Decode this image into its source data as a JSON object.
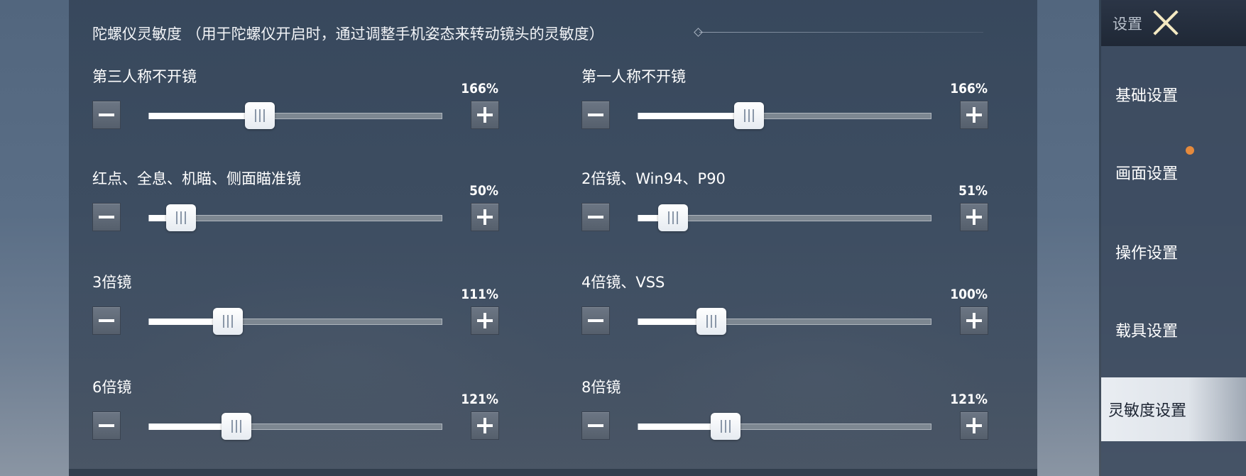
{
  "section": {
    "title": "陀螺仪灵敏度 （用于陀螺仪开启时，通过调整手机姿态来转动镜头的灵敏度）"
  },
  "sliders": [
    {
      "label": "第三人称不开镜",
      "value_text": "166%",
      "level": 0.38
    },
    {
      "label": "第一人称不开镜",
      "value_text": "166%",
      "level": 0.38
    },
    {
      "label": "红点、全息、机瞄、侧面瞄准镜",
      "value_text": "50%",
      "level": 0.11
    },
    {
      "label": "2倍镜、Win94、P90",
      "value_text": "51%",
      "level": 0.12
    },
    {
      "label": "3倍镜",
      "value_text": "111%",
      "level": 0.27
    },
    {
      "label": "4倍镜、VSS",
      "value_text": "100%",
      "level": 0.25
    },
    {
      "label": "6倍镜",
      "value_text": "121%",
      "level": 0.3
    },
    {
      "label": "8倍镜",
      "value_text": "121%",
      "level": 0.3
    }
  ],
  "sidebar": {
    "title": "设置",
    "close_icon": "close-x-icon",
    "items": [
      {
        "label": "基础设置",
        "active": false
      },
      {
        "label": "画面设置",
        "active": false,
        "notification_dot": true
      },
      {
        "label": "操作设置",
        "active": false
      },
      {
        "label": "载具设置",
        "active": false
      },
      {
        "label": "灵敏度设置",
        "active": true
      }
    ]
  },
  "colors": {
    "accent_dot": "#e58a3c",
    "active_nav_bg": "#e9edf2",
    "slider_fill": "#ffffff"
  }
}
